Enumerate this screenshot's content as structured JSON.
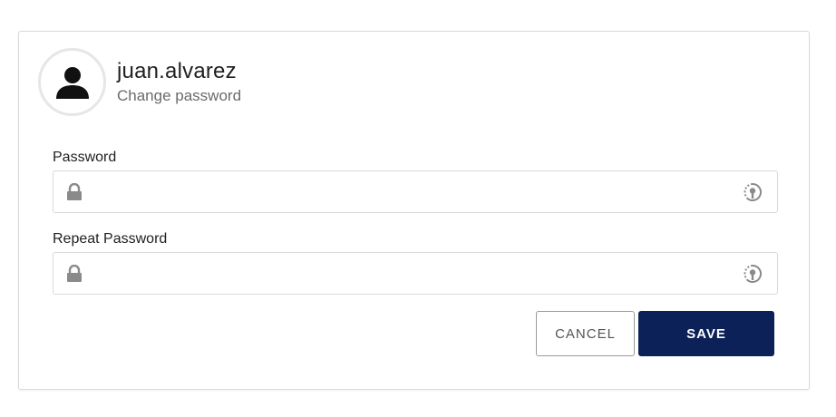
{
  "header": {
    "username": "juan.alvarez",
    "subtitle": "Change password"
  },
  "form": {
    "password": {
      "label": "Password",
      "value": "",
      "placeholder": ""
    },
    "repeat_password": {
      "label": "Repeat Password",
      "value": "",
      "placeholder": ""
    }
  },
  "actions": {
    "cancel_label": "CANCEL",
    "save_label": "SAVE"
  },
  "icons": {
    "avatar": "user-icon",
    "field_prefix": "lock-icon",
    "field_suffix": "show-password-icon"
  },
  "colors": {
    "primary": "#0b2157",
    "border": "#d9d9d9",
    "icon_gray": "#8a8a8a"
  }
}
